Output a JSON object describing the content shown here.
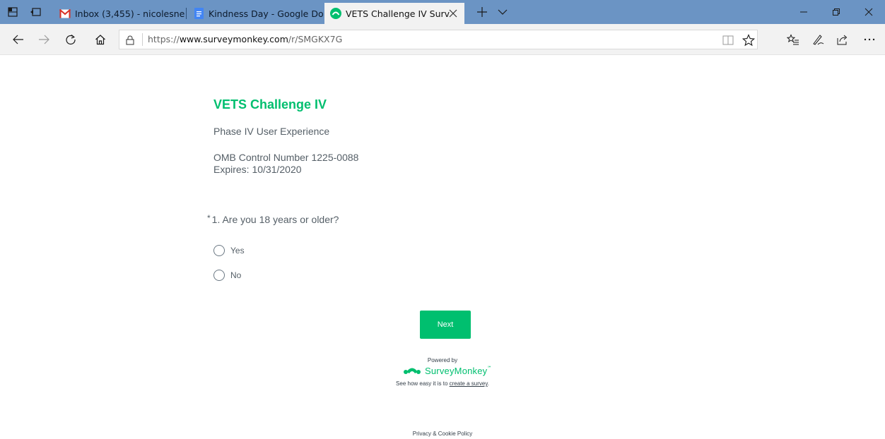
{
  "browser": {
    "tabs": [
      {
        "title": "Inbox (3,455) - nicolesneri@",
        "favicon": "gmail-icon",
        "active": false
      },
      {
        "title": "Kindness Day - Google Doc",
        "favicon": "google-docs-icon",
        "active": false
      },
      {
        "title": "VETS Challenge IV Surv",
        "favicon": "surveymonkey-icon",
        "active": true
      }
    ],
    "address": {
      "url_prefix": "https://",
      "url_domain": "www.surveymonkey.com",
      "url_path": "/r/SMGKX7G"
    }
  },
  "survey": {
    "title": "VETS Challenge IV",
    "description": "Phase IV User Experience",
    "omb_control": "OMB Control Number 1225-0088",
    "expires": "Expires: 10/31/2020",
    "question": {
      "required_marker": "*",
      "text": "1. Are you 18 years or older?",
      "options": [
        "Yes",
        "No"
      ]
    },
    "next_label": "Next"
  },
  "footer": {
    "powered_by": "Powered by",
    "brand": "SurveyMonkey",
    "tagline_prefix": "See how easy it is to ",
    "tagline_link": "create a survey",
    "tagline_suffix": ".",
    "privacy": "Privacy & Cookie Policy"
  },
  "colors": {
    "accent": "#00bf6f",
    "tabstrip": "#6b94c4",
    "text": "#555f67"
  }
}
